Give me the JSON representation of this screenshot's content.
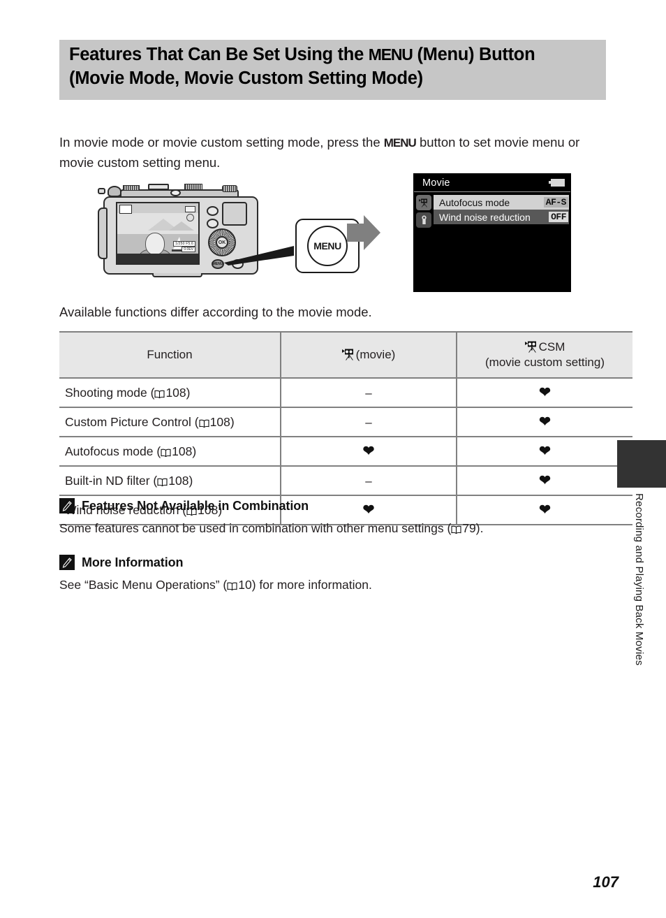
{
  "header": {
    "title_line1_pre": "Features That Can Be Set Using the ",
    "title_menu_glyph": "MENU",
    "title_line1_post": " (Menu) Button",
    "title_line2": "(Movie Mode, Movie Custom Setting Mode)",
    "background_color": "#c6c6c6"
  },
  "intro": {
    "pre": "In movie mode or movie custom setting mode, press the ",
    "menu_glyph": "MENU",
    "post": " button to set movie menu or movie custom setting menu."
  },
  "illustration": {
    "menu_button_label": "MENU",
    "camera_multiselector_label": "OK",
    "camera_menu_button_label": "MENU",
    "lcd": {
      "exposure_text": "1/250",
      "info_line1": "1/250  F5.6",
      "info_line2": "0.0EV"
    }
  },
  "menu_screen": {
    "title": "Movie",
    "battery_icon": "battery-icon",
    "tabs": [
      {
        "name": "movie-tab",
        "icon": "movie-camera-icon",
        "active": true
      },
      {
        "name": "setup-tab",
        "icon": "wrench-icon",
        "active": false
      }
    ],
    "rows": [
      {
        "label": "Autofocus mode",
        "value": "AF-S",
        "selected": true
      },
      {
        "label": "Wind noise reduction",
        "value": "OFF",
        "selected": false
      }
    ]
  },
  "available_line": "Available functions differ according to the movie mode.",
  "chart_data": {
    "type": "table",
    "title": "Available functions differ according to the movie mode.",
    "columns": [
      {
        "header": "Function",
        "icon": null
      },
      {
        "header": "(movie)",
        "icon": "movie-camera-icon"
      },
      {
        "header_line1": "CSM",
        "header_line2": "(movie custom setting)",
        "icon": "movie-camera-icon"
      }
    ],
    "rows": [
      {
        "function": "Shooting mode",
        "ref": "108",
        "movie": "–",
        "csm": "check"
      },
      {
        "function": "Custom Picture Control",
        "ref": "108",
        "movie": "–",
        "csm": "check"
      },
      {
        "function": "Autofocus mode",
        "ref": "108",
        "movie": "check",
        "csm": "check"
      },
      {
        "function": "Built-in ND filter",
        "ref": "108",
        "movie": "–",
        "csm": "check"
      },
      {
        "function": "Wind noise reduction",
        "ref": "108",
        "movie": "check",
        "csm": "check"
      }
    ],
    "symbols": {
      "check": "❤",
      "dash": "–"
    }
  },
  "notes": [
    {
      "icon": "pencil-note-icon",
      "title": "Features Not Available in Combination",
      "body_pre": "Some features cannot be used in combination with other menu settings (",
      "body_ref": "79",
      "body_post": ")."
    },
    {
      "icon": "pencil-note-icon",
      "title": "More Information",
      "body_pre": "See “Basic Menu Operations” (",
      "body_ref": "10",
      "body_post": ") for more information."
    }
  ],
  "side_tab": {
    "text": "Recording and Playing Back Movies",
    "block_color": "#333333"
  },
  "page_number": "107"
}
